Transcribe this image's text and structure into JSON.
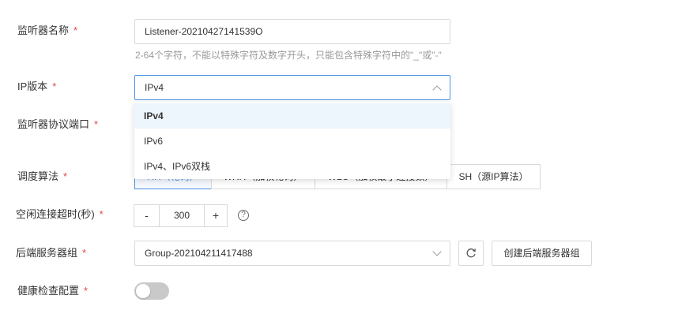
{
  "listener_name": {
    "label": "监听器名称",
    "required": "*",
    "value": "Listener-20210427141539O",
    "hint": "2-64个字符，不能以特殊字符及数字开头，只能包含特殊字符中的\"_\"或\"-\""
  },
  "ip_version": {
    "label": "IP版本",
    "required": "*",
    "value": "IPv4",
    "options": [
      "IPv4",
      "IPv6",
      "IPv4、IPv6双栈"
    ],
    "selected_option": "IPv4"
  },
  "protocol_port": {
    "label": "监听器协议端口",
    "required": "*"
  },
  "scheduling": {
    "label": "调度算法",
    "required": "*",
    "options": [
      "RR（轮询）",
      "WRR（加权轮询）",
      "WLC（加权最小连接数）",
      "SH（源IP算法）"
    ],
    "selected": "RR（轮询）"
  },
  "idle_timeout": {
    "label": "空闲连接超时(秒)",
    "required": "*",
    "minus": "-",
    "value": "300",
    "plus": "+",
    "help": "?"
  },
  "backend_group": {
    "label": "后端服务器组",
    "required": "*",
    "value": "Group-202104211417488",
    "create_label": "创建后端服务器组"
  },
  "health_check": {
    "label": "健康检查配置",
    "required": "*",
    "enabled": false
  },
  "colors": {
    "accent": "#4a90e2",
    "required": "#e54545",
    "border": "#d9d9d9",
    "hint": "#999999",
    "option_highlight": "#eef6fd",
    "toggle_off": "#c9c9c9"
  },
  "icons": {
    "ip_chevron": "chevron-up-icon",
    "group_chevron": "chevron-down-icon",
    "refresh": "refresh-icon",
    "help": "help-circle-icon"
  }
}
